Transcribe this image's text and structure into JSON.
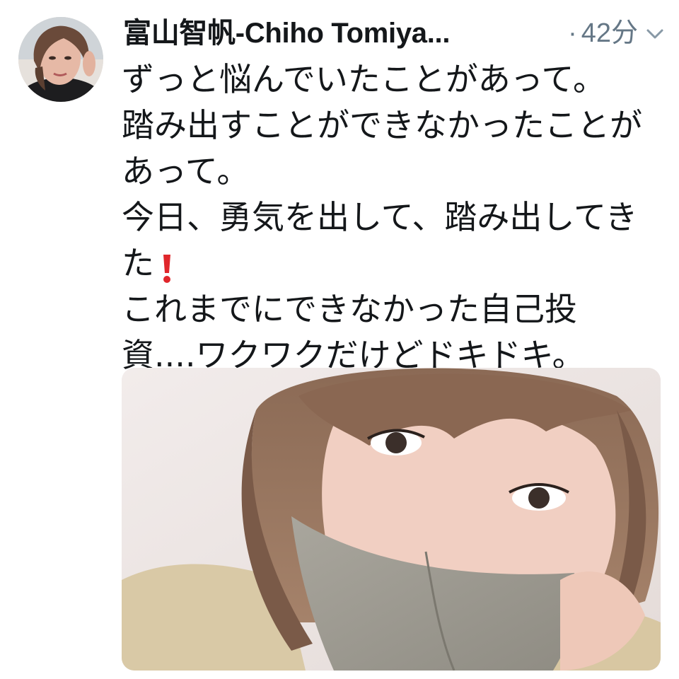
{
  "tweet": {
    "author": {
      "display_name": "富山智帆-Chiho Tomiya..."
    },
    "meta": {
      "separator": "·",
      "time": "42分"
    },
    "menu_icon": "chevron-down-icon",
    "text_lines": [
      "ずっと悩んでいたことがあって。",
      "踏み出すことができなかったことが",
      "あって。",
      "今日、勇気を出して、踏み出してき",
      "た",
      "これまでにできなかった自己投",
      "資....ワクワクだけどドキドキ。"
    ],
    "emoji": "red-exclamation-icon",
    "colors": {
      "text": "#14171a",
      "meta": "#657786",
      "exclamation": "#e0262b"
    }
  }
}
